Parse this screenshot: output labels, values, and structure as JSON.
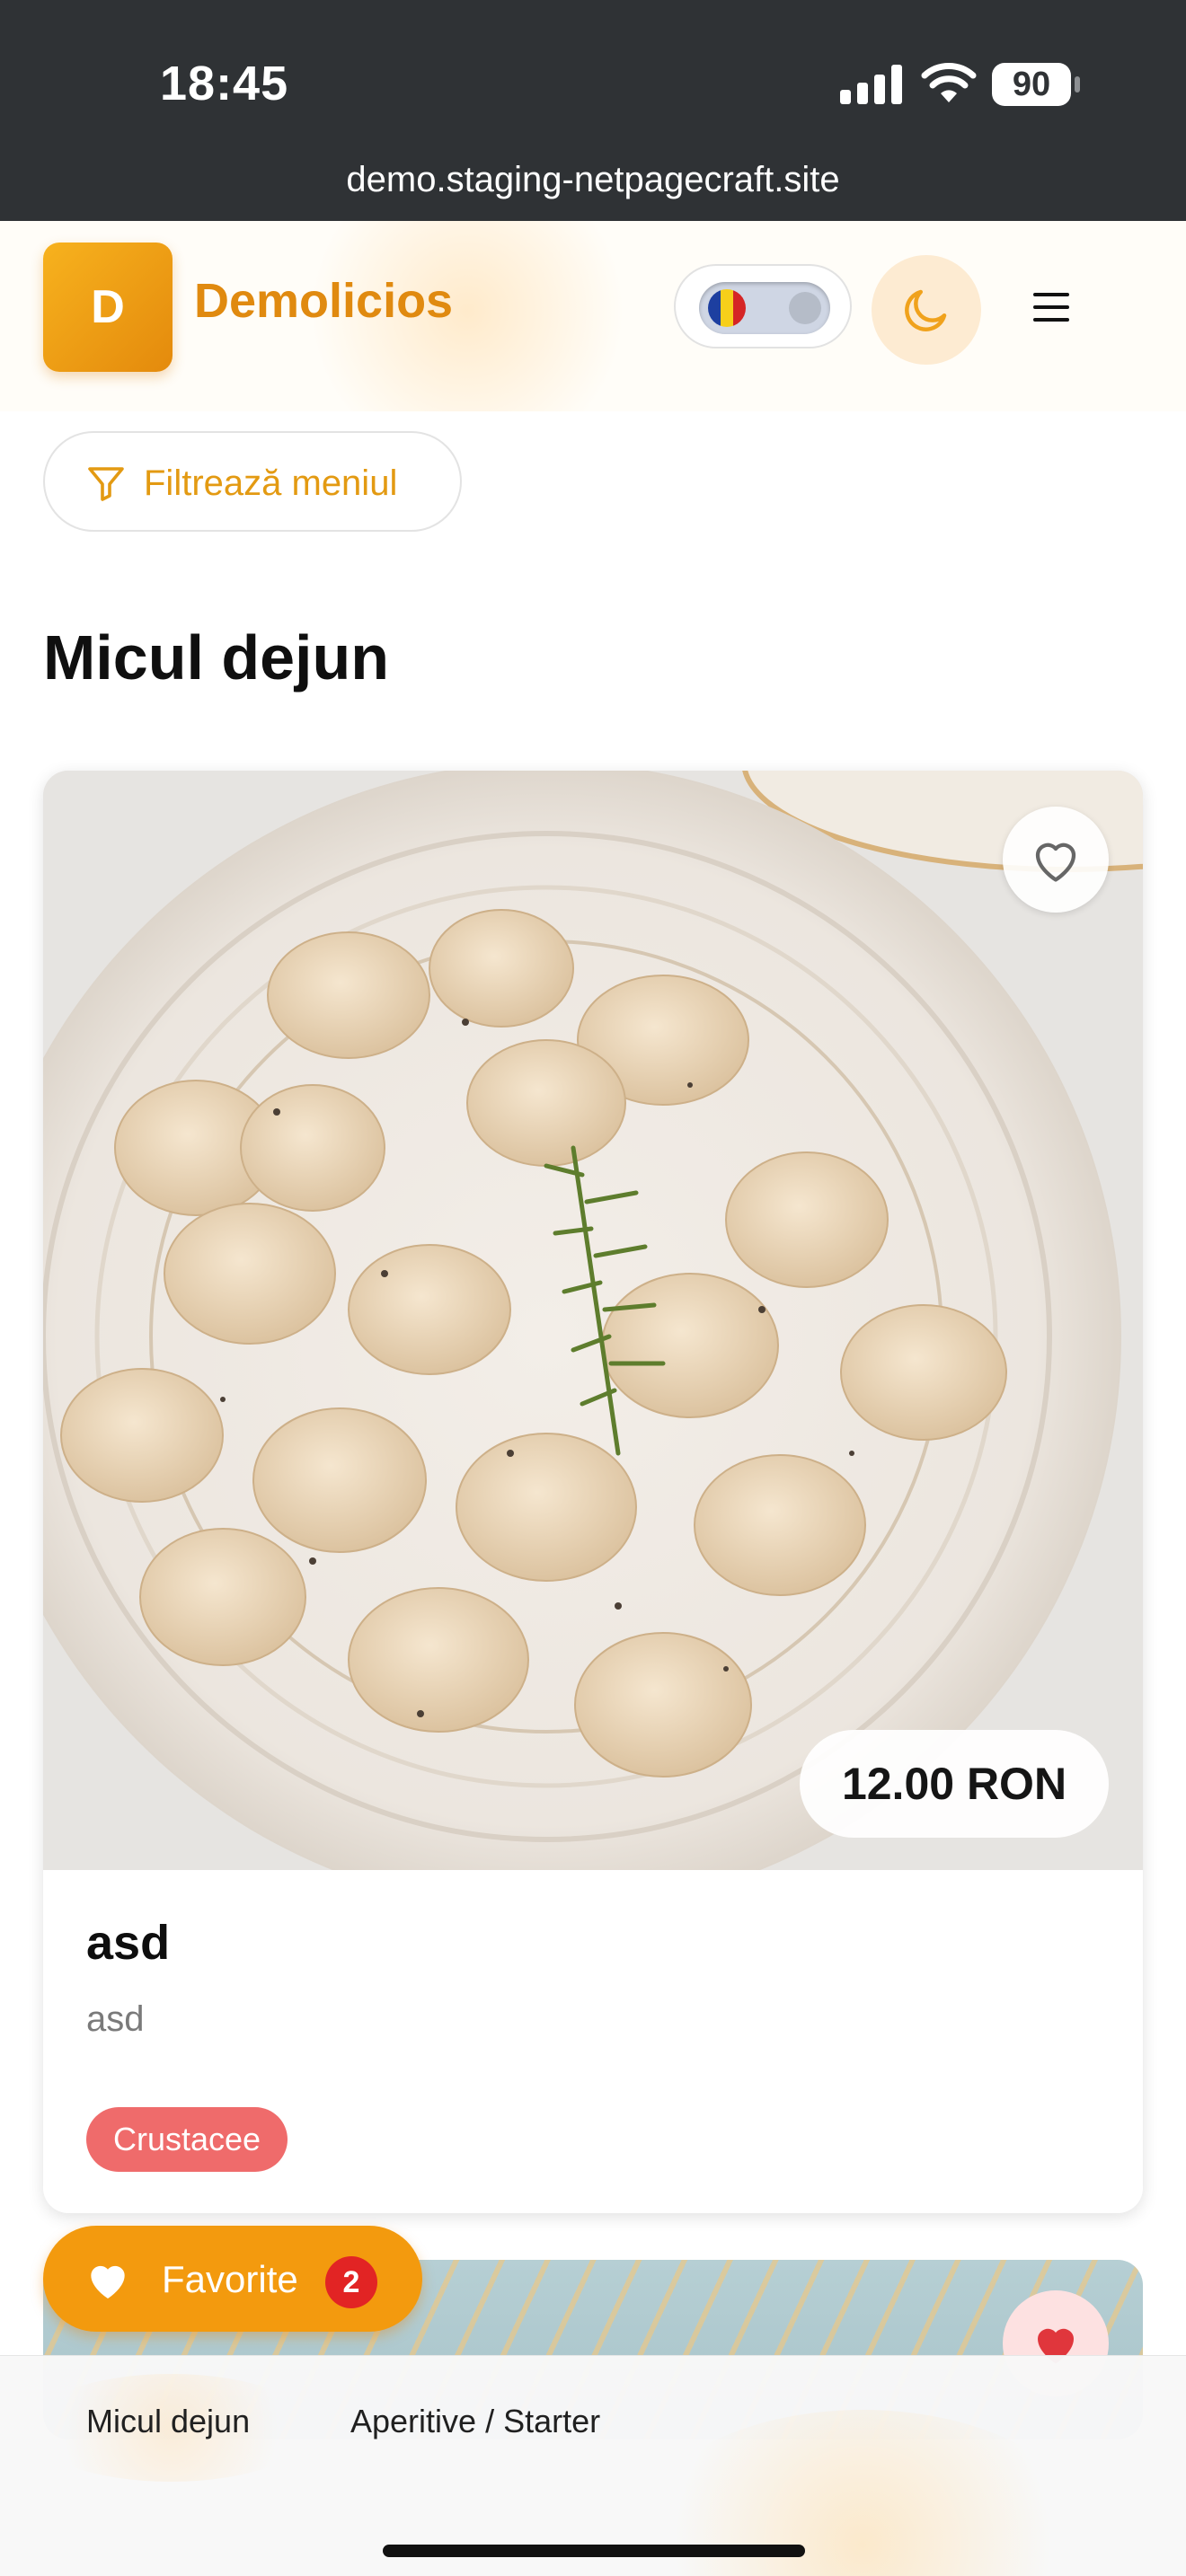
{
  "status_bar": {
    "time": "18:45",
    "battery": "90",
    "url": "demo.staging-netpagecraft.site"
  },
  "header": {
    "logo_letter": "D",
    "brand_name": "Demolicios",
    "language_flag": "romania-flag-icon",
    "theme_icon": "moon-icon",
    "menu_icon": "hamburger-menu-icon",
    "accent_color": "#e08a10"
  },
  "filter": {
    "label": "Filtrează meniul",
    "icon": "filter-icon"
  },
  "section": {
    "title": "Micul dejun"
  },
  "card": {
    "image_alt": "Plate of dumplings with dill",
    "price": "12.00 RON",
    "title": "asd",
    "description": "asd",
    "tag": "Crustacee",
    "tag_color": "#ef6b6b",
    "favorite_icon": "heart-outline-icon"
  },
  "favorites": {
    "label": "Favorite",
    "count": "2",
    "icon": "heart-icon"
  },
  "categories": [
    {
      "label": "Micul dejun"
    },
    {
      "label": "Aperitive / Starter"
    }
  ]
}
